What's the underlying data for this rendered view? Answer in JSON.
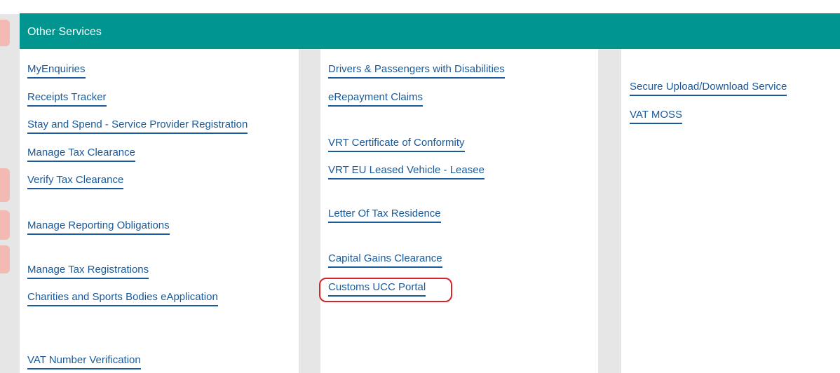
{
  "panel": {
    "title": "Other Services"
  },
  "columns": {
    "col1": [
      "MyEnquiries",
      "Receipts Tracker",
      "Stay and Spend - Service Provider Registration",
      "Manage Tax Clearance",
      "Verify Tax Clearance",
      "Manage Reporting Obligations",
      "Manage Tax Registrations",
      "Charities and Sports Bodies eApplication",
      "VAT Number Verification"
    ],
    "col2": [
      "Drivers & Passengers with Disabilities",
      "eRepayment Claims",
      "VRT Certificate of Conformity",
      "VRT EU Leased Vehicle - Leasee",
      "Letter Of Tax Residence",
      "Capital Gains Clearance",
      "Customs UCC Portal"
    ],
    "col3": [
      "Secure Upload/Download Service",
      "VAT MOSS"
    ]
  },
  "colors": {
    "header_bg": "#00968f",
    "link": "#1a5a9a",
    "highlight": "#d9242a",
    "side_mark": "#f3b9b3"
  }
}
